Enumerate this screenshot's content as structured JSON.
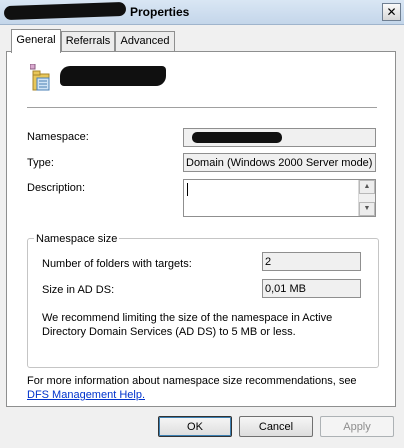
{
  "window": {
    "title": "Properties",
    "close_glyph": "✕"
  },
  "tabs": [
    {
      "label": "General",
      "active": true
    },
    {
      "label": "Referrals",
      "active": false
    },
    {
      "label": "Advanced",
      "active": false
    }
  ],
  "general": {
    "namespace": {
      "label": "Namespace:",
      "value": ""
    },
    "type": {
      "label": "Type:",
      "value": "Domain (Windows 2000 Server mode)"
    },
    "description": {
      "label": "Description:",
      "value": ""
    }
  },
  "namespace_size": {
    "title": "Namespace size",
    "folders_label": "Number of folders with targets:",
    "folders_value": "2",
    "size_label": "Size in AD DS:",
    "size_value": "0,01 MB",
    "recommendation": "We recommend limiting the size of the namespace in Active Directory Domain Services (AD DS) to 5 MB or less."
  },
  "footer": {
    "info_text": "For more information about namespace size recommendations, see",
    "help_link": "DFS Management Help."
  },
  "buttons": {
    "ok": "OK",
    "cancel": "Cancel",
    "apply": "Apply"
  },
  "icons": {
    "object": "namespace-folder-icon",
    "scroll_up": "▲",
    "scroll_down": "▼"
  }
}
